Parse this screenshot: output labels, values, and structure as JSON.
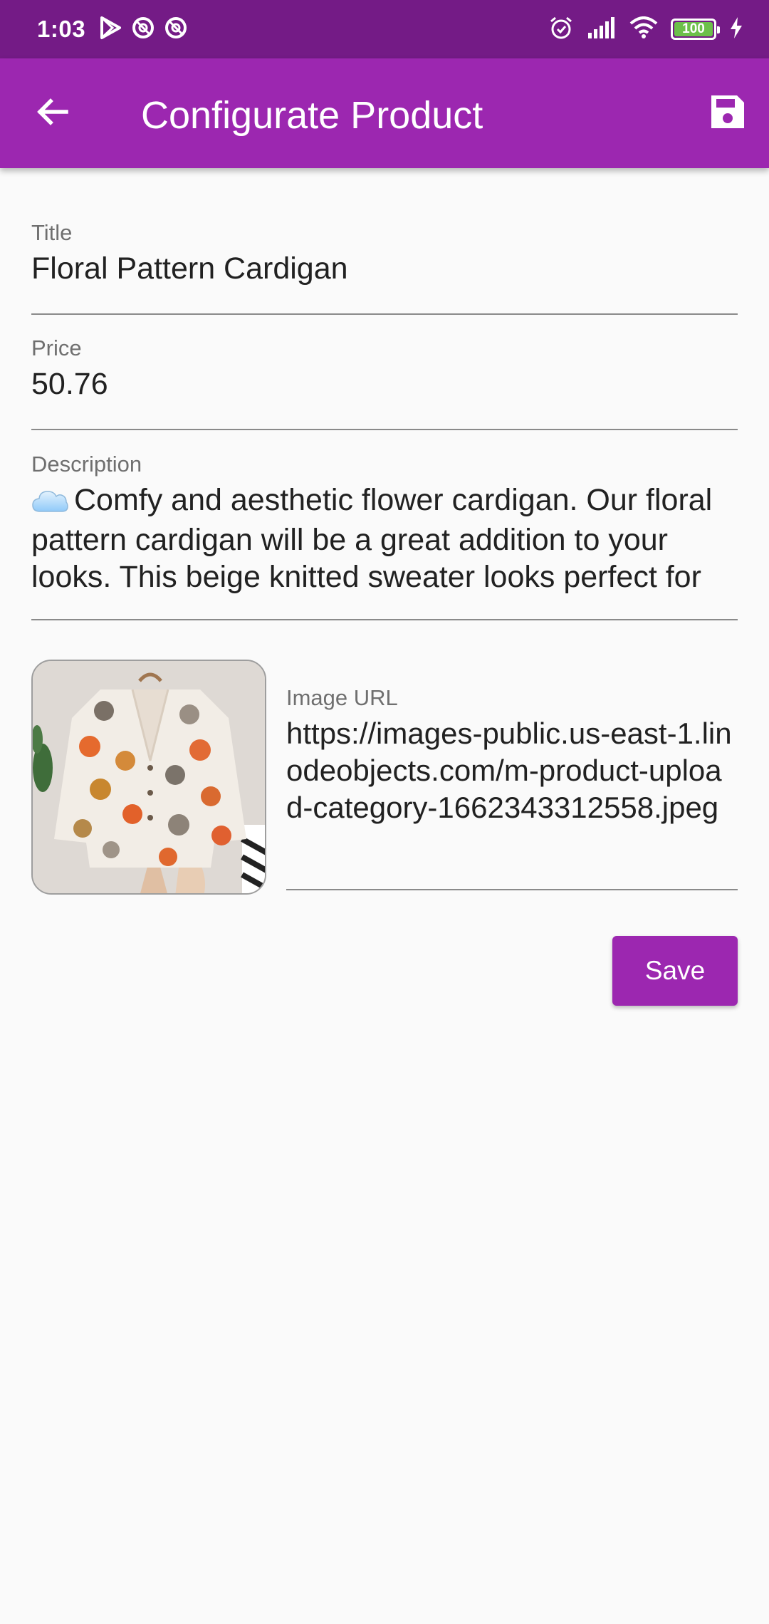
{
  "status_bar": {
    "time": "1:03",
    "battery": "100",
    "left_icons": [
      "play-store-icon",
      "notification-icon",
      "notification-icon"
    ],
    "right_icons": [
      "alarm-icon",
      "signal-icon",
      "wifi-icon",
      "battery-icon",
      "charging-icon"
    ]
  },
  "app_bar": {
    "title": "Configurate Product",
    "back_icon": "arrow-back-icon",
    "action_icon": "save-icon",
    "color": "#9c27b0"
  },
  "form": {
    "title": {
      "label": "Title",
      "value": "Floral Pattern Cardigan"
    },
    "price": {
      "label": "Price",
      "value": "50.76"
    },
    "description": {
      "label": "Description",
      "emoji": "☁️",
      "value": "Comfy and aesthetic flower cardigan. Our floral pattern cardigan will be a great addition to your looks. This beige knitted sweater looks perfect for"
    },
    "image_url": {
      "label": "Image URL",
      "value": "https://images-public.us-east-1.linodeobjects.com/m-product-upload-category-1662343312558.jpeg"
    }
  },
  "save_button": {
    "label": "Save"
  },
  "colors": {
    "status_bar": "#741b86",
    "accent": "#9c27b0",
    "background": "#fafafa"
  }
}
